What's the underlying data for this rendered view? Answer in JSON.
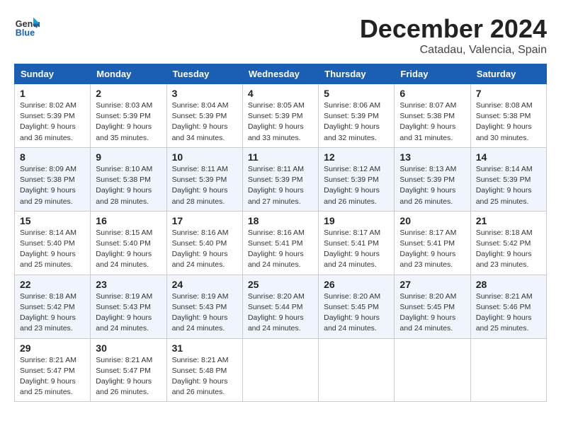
{
  "header": {
    "logo_line1": "General",
    "logo_line2": "Blue",
    "month": "December 2024",
    "location": "Catadau, Valencia, Spain"
  },
  "weekdays": [
    "Sunday",
    "Monday",
    "Tuesday",
    "Wednesday",
    "Thursday",
    "Friday",
    "Saturday"
  ],
  "weeks": [
    [
      {
        "day": "1",
        "sunrise": "Sunrise: 8:02 AM",
        "sunset": "Sunset: 5:39 PM",
        "daylight": "Daylight: 9 hours and 36 minutes."
      },
      {
        "day": "2",
        "sunrise": "Sunrise: 8:03 AM",
        "sunset": "Sunset: 5:39 PM",
        "daylight": "Daylight: 9 hours and 35 minutes."
      },
      {
        "day": "3",
        "sunrise": "Sunrise: 8:04 AM",
        "sunset": "Sunset: 5:39 PM",
        "daylight": "Daylight: 9 hours and 34 minutes."
      },
      {
        "day": "4",
        "sunrise": "Sunrise: 8:05 AM",
        "sunset": "Sunset: 5:39 PM",
        "daylight": "Daylight: 9 hours and 33 minutes."
      },
      {
        "day": "5",
        "sunrise": "Sunrise: 8:06 AM",
        "sunset": "Sunset: 5:39 PM",
        "daylight": "Daylight: 9 hours and 32 minutes."
      },
      {
        "day": "6",
        "sunrise": "Sunrise: 8:07 AM",
        "sunset": "Sunset: 5:38 PM",
        "daylight": "Daylight: 9 hours and 31 minutes."
      },
      {
        "day": "7",
        "sunrise": "Sunrise: 8:08 AM",
        "sunset": "Sunset: 5:38 PM",
        "daylight": "Daylight: 9 hours and 30 minutes."
      }
    ],
    [
      {
        "day": "8",
        "sunrise": "Sunrise: 8:09 AM",
        "sunset": "Sunset: 5:38 PM",
        "daylight": "Daylight: 9 hours and 29 minutes."
      },
      {
        "day": "9",
        "sunrise": "Sunrise: 8:10 AM",
        "sunset": "Sunset: 5:38 PM",
        "daylight": "Daylight: 9 hours and 28 minutes."
      },
      {
        "day": "10",
        "sunrise": "Sunrise: 8:11 AM",
        "sunset": "Sunset: 5:39 PM",
        "daylight": "Daylight: 9 hours and 28 minutes."
      },
      {
        "day": "11",
        "sunrise": "Sunrise: 8:11 AM",
        "sunset": "Sunset: 5:39 PM",
        "daylight": "Daylight: 9 hours and 27 minutes."
      },
      {
        "day": "12",
        "sunrise": "Sunrise: 8:12 AM",
        "sunset": "Sunset: 5:39 PM",
        "daylight": "Daylight: 9 hours and 26 minutes."
      },
      {
        "day": "13",
        "sunrise": "Sunrise: 8:13 AM",
        "sunset": "Sunset: 5:39 PM",
        "daylight": "Daylight: 9 hours and 26 minutes."
      },
      {
        "day": "14",
        "sunrise": "Sunrise: 8:14 AM",
        "sunset": "Sunset: 5:39 PM",
        "daylight": "Daylight: 9 hours and 25 minutes."
      }
    ],
    [
      {
        "day": "15",
        "sunrise": "Sunrise: 8:14 AM",
        "sunset": "Sunset: 5:40 PM",
        "daylight": "Daylight: 9 hours and 25 minutes."
      },
      {
        "day": "16",
        "sunrise": "Sunrise: 8:15 AM",
        "sunset": "Sunset: 5:40 PM",
        "daylight": "Daylight: 9 hours and 24 minutes."
      },
      {
        "day": "17",
        "sunrise": "Sunrise: 8:16 AM",
        "sunset": "Sunset: 5:40 PM",
        "daylight": "Daylight: 9 hours and 24 minutes."
      },
      {
        "day": "18",
        "sunrise": "Sunrise: 8:16 AM",
        "sunset": "Sunset: 5:41 PM",
        "daylight": "Daylight: 9 hours and 24 minutes."
      },
      {
        "day": "19",
        "sunrise": "Sunrise: 8:17 AM",
        "sunset": "Sunset: 5:41 PM",
        "daylight": "Daylight: 9 hours and 24 minutes."
      },
      {
        "day": "20",
        "sunrise": "Sunrise: 8:17 AM",
        "sunset": "Sunset: 5:41 PM",
        "daylight": "Daylight: 9 hours and 23 minutes."
      },
      {
        "day": "21",
        "sunrise": "Sunrise: 8:18 AM",
        "sunset": "Sunset: 5:42 PM",
        "daylight": "Daylight: 9 hours and 23 minutes."
      }
    ],
    [
      {
        "day": "22",
        "sunrise": "Sunrise: 8:18 AM",
        "sunset": "Sunset: 5:42 PM",
        "daylight": "Daylight: 9 hours and 23 minutes."
      },
      {
        "day": "23",
        "sunrise": "Sunrise: 8:19 AM",
        "sunset": "Sunset: 5:43 PM",
        "daylight": "Daylight: 9 hours and 24 minutes."
      },
      {
        "day": "24",
        "sunrise": "Sunrise: 8:19 AM",
        "sunset": "Sunset: 5:43 PM",
        "daylight": "Daylight: 9 hours and 24 minutes."
      },
      {
        "day": "25",
        "sunrise": "Sunrise: 8:20 AM",
        "sunset": "Sunset: 5:44 PM",
        "daylight": "Daylight: 9 hours and 24 minutes."
      },
      {
        "day": "26",
        "sunrise": "Sunrise: 8:20 AM",
        "sunset": "Sunset: 5:45 PM",
        "daylight": "Daylight: 9 hours and 24 minutes."
      },
      {
        "day": "27",
        "sunrise": "Sunrise: 8:20 AM",
        "sunset": "Sunset: 5:45 PM",
        "daylight": "Daylight: 9 hours and 24 minutes."
      },
      {
        "day": "28",
        "sunrise": "Sunrise: 8:21 AM",
        "sunset": "Sunset: 5:46 PM",
        "daylight": "Daylight: 9 hours and 25 minutes."
      }
    ],
    [
      {
        "day": "29",
        "sunrise": "Sunrise: 8:21 AM",
        "sunset": "Sunset: 5:47 PM",
        "daylight": "Daylight: 9 hours and 25 minutes."
      },
      {
        "day": "30",
        "sunrise": "Sunrise: 8:21 AM",
        "sunset": "Sunset: 5:47 PM",
        "daylight": "Daylight: 9 hours and 26 minutes."
      },
      {
        "day": "31",
        "sunrise": "Sunrise: 8:21 AM",
        "sunset": "Sunset: 5:48 PM",
        "daylight": "Daylight: 9 hours and 26 minutes."
      },
      null,
      null,
      null,
      null
    ]
  ]
}
